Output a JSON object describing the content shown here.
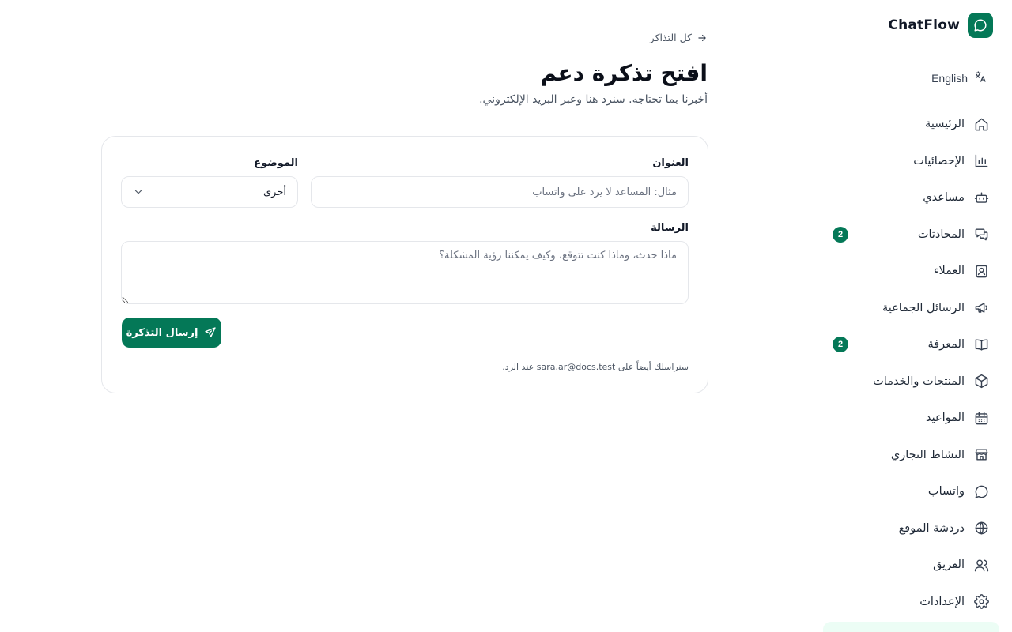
{
  "brand": {
    "name": "ChatFlow",
    "logo_icon": "chat-bubble-icon",
    "color": "#047857"
  },
  "language": {
    "label": "English",
    "icon": "translate-icon"
  },
  "sidebar": {
    "items": [
      {
        "label": "الرئيسية",
        "icon": "home-icon"
      },
      {
        "label": "الإحصائيات",
        "icon": "bar-chart-icon"
      },
      {
        "label": "مساعدي",
        "icon": "bot-icon"
      },
      {
        "label": "المحادثات",
        "icon": "conversations-icon",
        "badge": "2"
      },
      {
        "label": "العملاء",
        "icon": "contact-card-icon"
      },
      {
        "label": "الرسائل الجماعية",
        "icon": "megaphone-icon"
      },
      {
        "label": "المعرفة",
        "icon": "book-icon",
        "badge": "2"
      },
      {
        "label": "المنتجات والخدمات",
        "icon": "box-icon"
      },
      {
        "label": "المواعيد",
        "icon": "calendar-icon"
      },
      {
        "label": "النشاط التجاري",
        "icon": "store-icon"
      },
      {
        "label": "واتساب",
        "icon": "whatsapp-icon"
      },
      {
        "label": "دردشة الموقع",
        "icon": "globe-icon"
      },
      {
        "label": "الفريق",
        "icon": "users-icon"
      },
      {
        "label": "الإعدادات",
        "icon": "gear-icon"
      }
    ]
  },
  "main": {
    "back_label": "كل التذاكر",
    "title": "افتح تذكرة دعم",
    "subtitle": "أخبرنا بما تحتاجه. سنرد هنا وعبر البريد الإلكتروني.",
    "form": {
      "title_label": "العنوان",
      "title_placeholder": "مثال: المساعد لا يرد على واتساب",
      "title_value": "",
      "topic_label": "الموضوع",
      "topic_value": "أخرى",
      "message_label": "الرسالة",
      "message_placeholder": "ماذا حدث، وماذا كنت تتوقع، وكيف يمكننا رؤية المشكلة؟",
      "message_value": "",
      "submit_label": "إرسال التذكرة",
      "note": "سنراسلك أيضاً على sara.ar@docs.test عند الرد."
    }
  }
}
